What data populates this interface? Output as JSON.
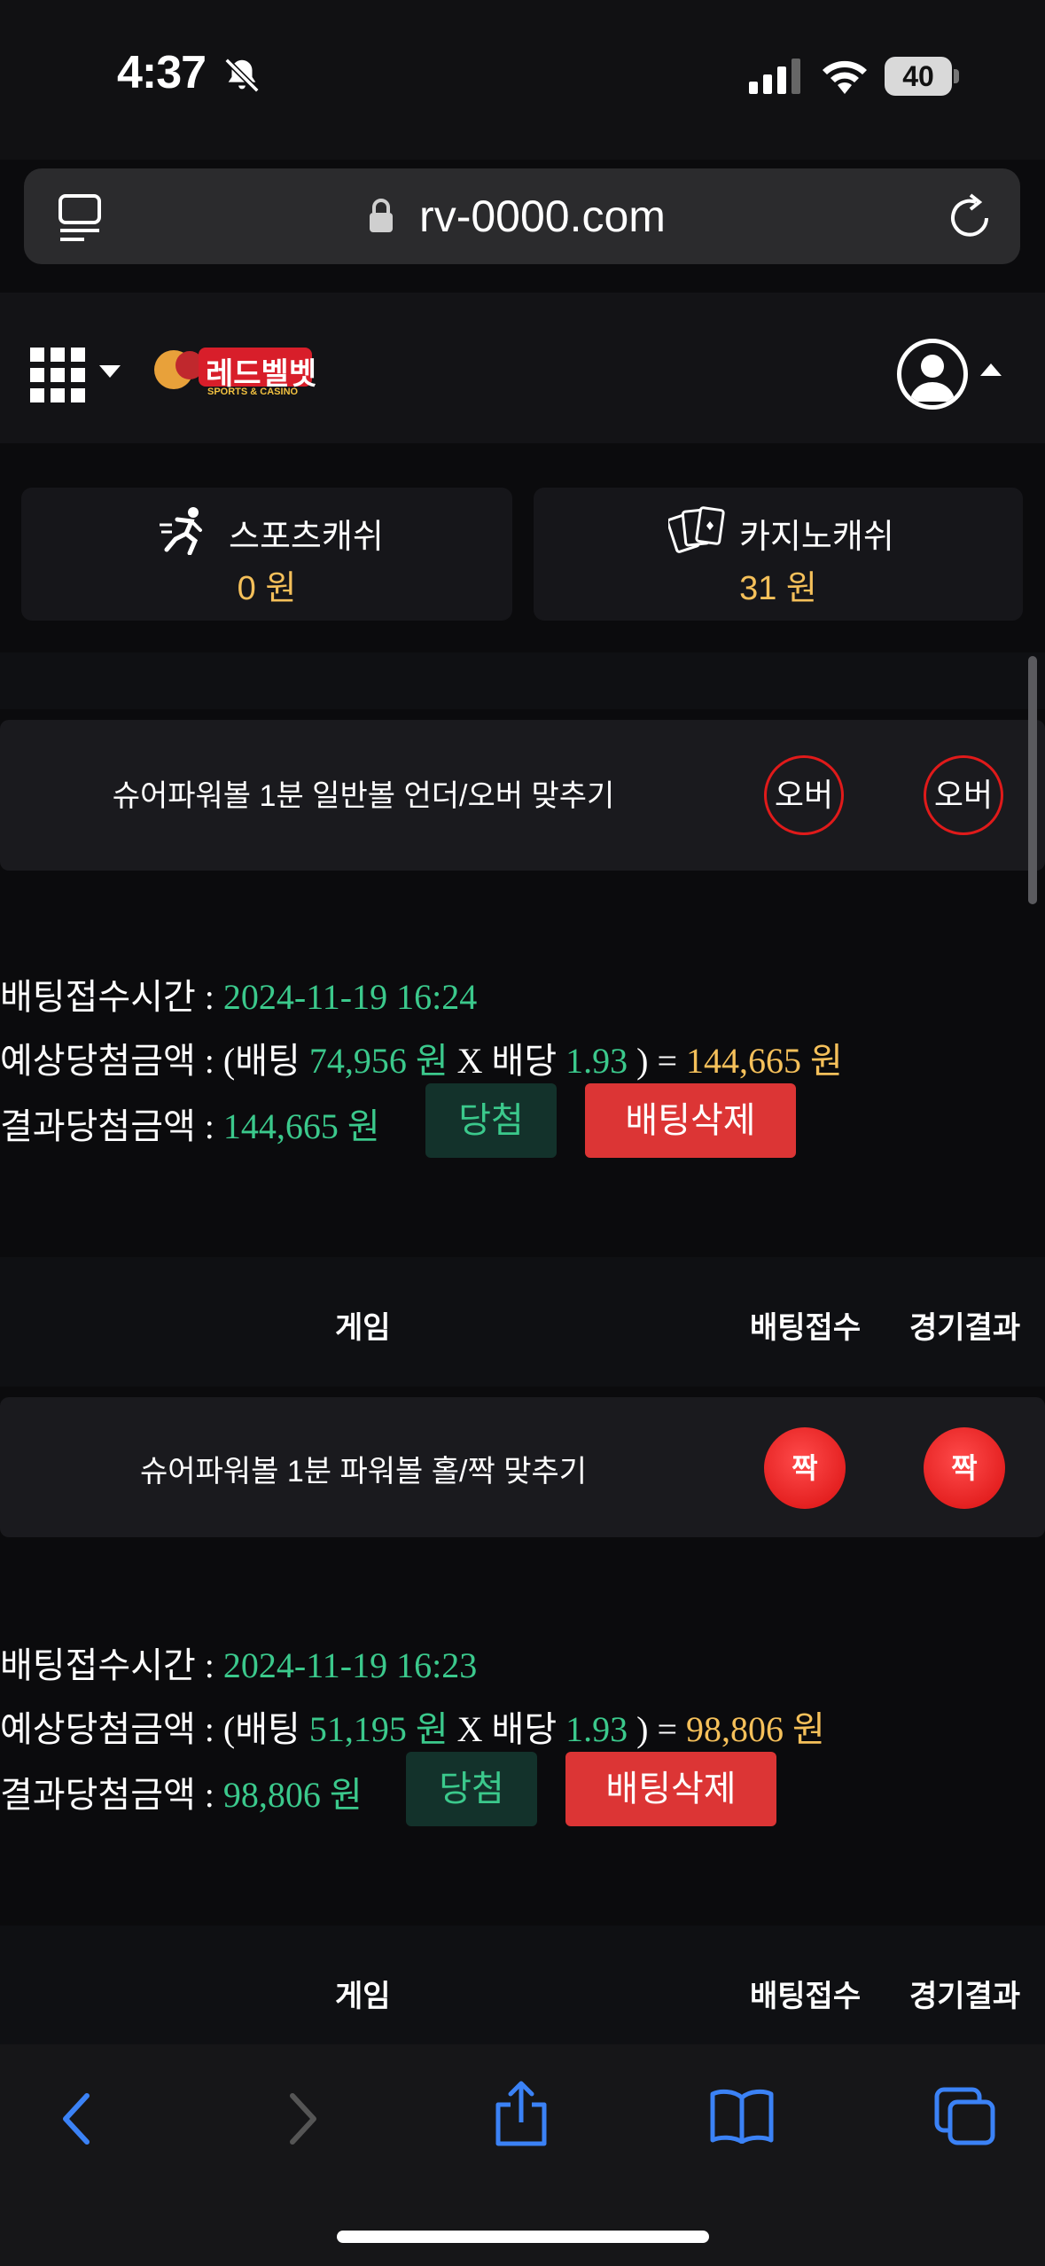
{
  "status_bar": {
    "time": "4:37",
    "battery": "40"
  },
  "browser": {
    "url": "rv-0000.com"
  },
  "site": {
    "logo_text": "레드벨벳",
    "logo_sub": "SPORTS & CASINO"
  },
  "cash": {
    "sports": {
      "label": "스포츠캐쉬",
      "value": "0 원"
    },
    "casino": {
      "label": "카지노캐쉬",
      "value": "31 원"
    }
  },
  "bets": [
    {
      "game": "슈어파워볼 1분 일반볼 언더/오버 맞추기",
      "bet_pick": "오버",
      "result": "오버",
      "time_label": "배팅접수시간 : ",
      "time": "2024-11-19 16:24",
      "expected_label": "예상당첨금액 : (배팅 ",
      "stake": "74,956 원",
      "x_label": " X 배당 ",
      "odds": "1.93",
      "eq_label": " ) = ",
      "expected": "144,665 원",
      "result_label": "결과당첨금액 : ",
      "payout": "144,665 원",
      "status": "당첨",
      "delete": "배팅삭제"
    },
    {
      "game": "슈어파워볼 1분 파워볼 홀/짝 맞추기",
      "bet_pick": "짝",
      "result": "짝",
      "time_label": "배팅접수시간 : ",
      "time": "2024-11-19 16:23",
      "expected_label": "예상당첨금액 : (배팅 ",
      "stake": "51,195 원",
      "x_label": " X 배당 ",
      "odds": "1.93",
      "eq_label": " ) = ",
      "expected": "98,806 원",
      "result_label": "결과당첨금액 : ",
      "payout": "98,806 원",
      "status": "당첨",
      "delete": "배팅삭제"
    }
  ],
  "table_header": {
    "game": "게임",
    "bet": "배팅접수",
    "result": "경기결과"
  },
  "colors": {
    "accent_green": "#3bc98c",
    "accent_gold": "#f5c05a",
    "delete_red": "#dc3535",
    "ball_red": "#e01a1a"
  },
  "icons": [
    "bell-slash-icon",
    "signal-icon",
    "wifi-icon",
    "battery-icon",
    "tabs-icon",
    "lock-icon",
    "reload-icon",
    "grid-menu-icon",
    "chevron-down-icon",
    "user-avatar-icon",
    "runner-icon",
    "cards-icon",
    "back-icon",
    "forward-icon",
    "share-icon",
    "bookmarks-icon",
    "tabs-overview-icon"
  ]
}
